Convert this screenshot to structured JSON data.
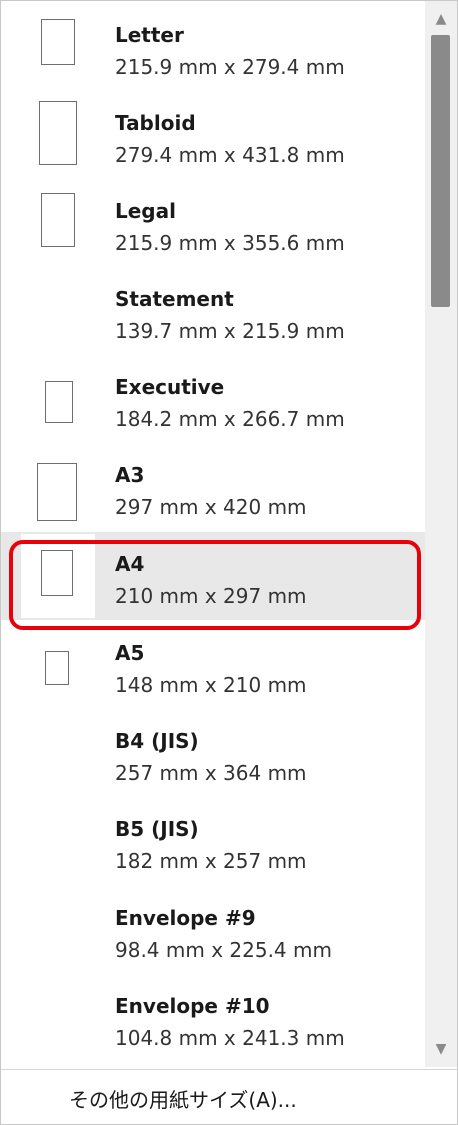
{
  "paper_sizes": [
    {
      "name": "Letter",
      "dims": "215.9 mm x 279.4 mm",
      "icon": "letter-page-icon"
    },
    {
      "name": "Tabloid",
      "dims": "279.4 mm x 431.8 mm",
      "icon": "tabloid-page-icon"
    },
    {
      "name": "Legal",
      "dims": "215.9 mm x 355.6 mm",
      "icon": "legal-page-icon"
    },
    {
      "name": "Statement",
      "dims": "139.7 mm x 215.9 mm",
      "icon": ""
    },
    {
      "name": "Executive",
      "dims": "184.2 mm x 266.7 mm",
      "icon": "executive-page-icon"
    },
    {
      "name": "A3",
      "dims": "297 mm x 420 mm",
      "icon": "a3-page-icon"
    },
    {
      "name": "A4",
      "dims": "210 mm x 297 mm",
      "icon": "a4-page-icon",
      "selected": true
    },
    {
      "name": "A5",
      "dims": "148 mm x 210 mm",
      "icon": "a5-page-icon"
    },
    {
      "name": "B4 (JIS)",
      "dims": "257 mm x 364 mm",
      "icon": ""
    },
    {
      "name": "B5 (JIS)",
      "dims": "182 mm x 257 mm",
      "icon": ""
    },
    {
      "name": "Envelope #9",
      "dims": "98.4 mm x 225.4 mm",
      "icon": ""
    },
    {
      "name": "Envelope #10",
      "dims": "104.8 mm x 241.3 mm",
      "icon": ""
    }
  ],
  "footer": {
    "more_sizes_label": "その他の用紙サイズ(A)..."
  },
  "scrollbar": {
    "up_icon": "scroll-up-arrow-icon",
    "down_icon": "scroll-down-arrow-icon"
  },
  "colors": {
    "highlight_ring": "#e8000b",
    "selected_background": "#e8e8e8"
  }
}
